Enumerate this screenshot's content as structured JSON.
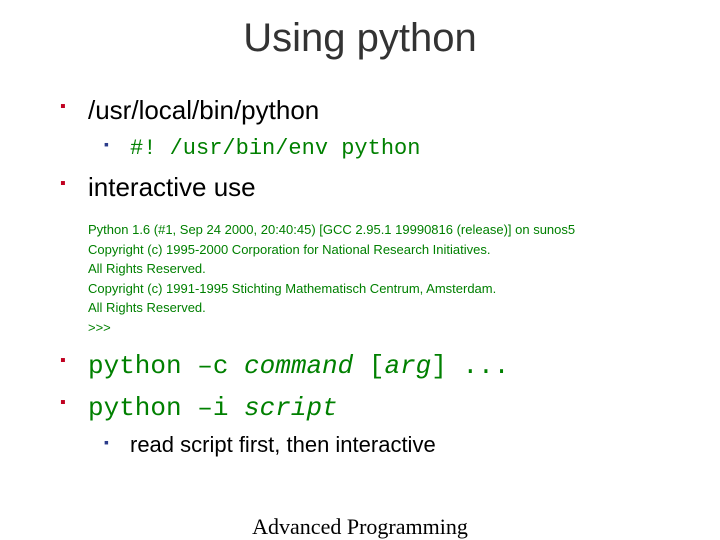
{
  "title": "Using python",
  "bullets": {
    "b1": "/usr/local/bin/python",
    "b1_sub": "#! /usr/bin/env python",
    "b2": "interactive use",
    "b3_pre": "python –c ",
    "b3_cmd": "command",
    "b3_mid": " [",
    "b3_arg": "arg",
    "b3_post": "] ...",
    "b4_pre": "python –i ",
    "b4_script": "script",
    "b4_sub": "read script first, then interactive"
  },
  "code": {
    "l1": "Python 1.6 (#1, Sep 24 2000, 20:40:45)  [GCC 2.95.1 19990816 (release)] on sunos5",
    "l2": "Copyright (c) 1995-2000 Corporation for National Research Initiatives.",
    "l3": "All Rights Reserved.",
    "l4": "Copyright (c) 1991-1995 Stichting Mathematisch Centrum, Amsterdam.",
    "l5": "All Rights Reserved.",
    "l6": ">>> "
  },
  "footer": "Advanced Programming"
}
